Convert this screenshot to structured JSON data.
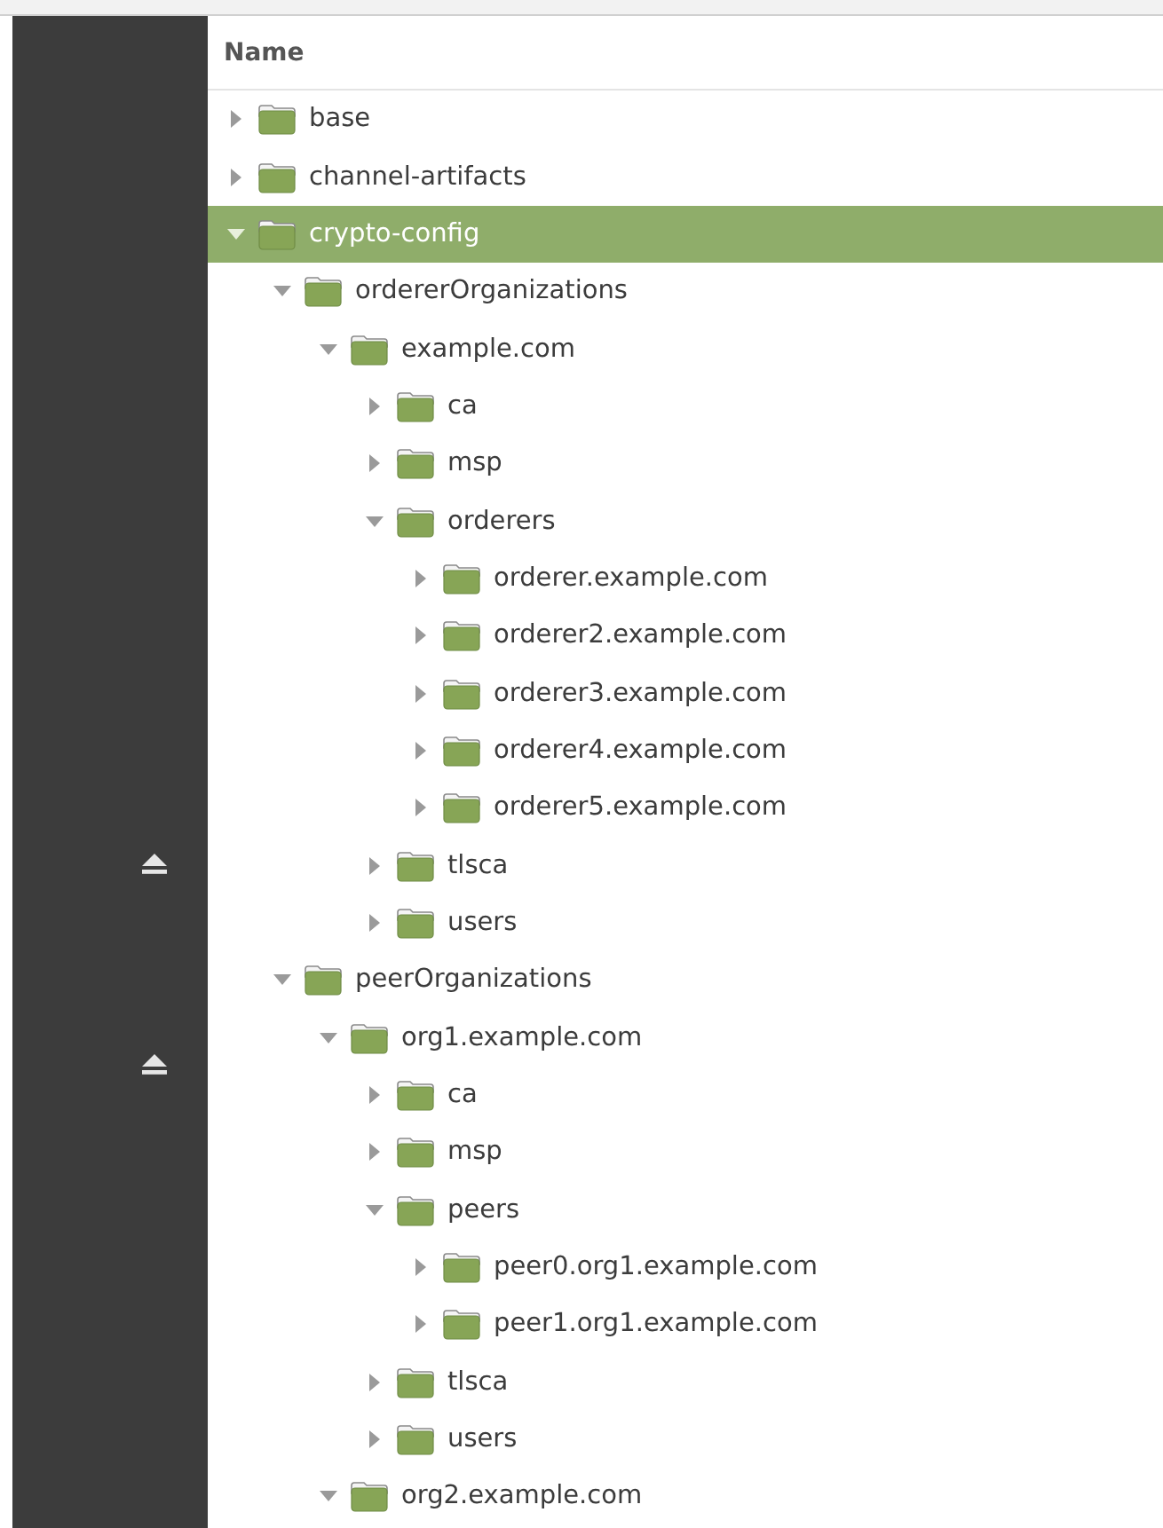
{
  "sidebar": {
    "buttons": [
      {
        "kind": "eject"
      },
      {
        "kind": "eject"
      }
    ]
  },
  "header": {
    "column_1": "Name"
  },
  "tree": [
    {
      "name": "base",
      "expanded": false,
      "selected": false
    },
    {
      "name": "channel-artifacts",
      "expanded": false,
      "selected": false
    },
    {
      "name": "crypto-config",
      "expanded": true,
      "selected": true,
      "children": [
        {
          "name": "ordererOrganizations",
          "expanded": true,
          "selected": false,
          "children": [
            {
              "name": "example.com",
              "expanded": true,
              "selected": false,
              "children": [
                {
                  "name": "ca",
                  "expanded": false,
                  "selected": false
                },
                {
                  "name": "msp",
                  "expanded": false,
                  "selected": false
                },
                {
                  "name": "orderers",
                  "expanded": true,
                  "selected": false,
                  "children": [
                    {
                      "name": "orderer.example.com",
                      "expanded": false,
                      "selected": false
                    },
                    {
                      "name": "orderer2.example.com",
                      "expanded": false,
                      "selected": false
                    },
                    {
                      "name": "orderer3.example.com",
                      "expanded": false,
                      "selected": false
                    },
                    {
                      "name": "orderer4.example.com",
                      "expanded": false,
                      "selected": false
                    },
                    {
                      "name": "orderer5.example.com",
                      "expanded": false,
                      "selected": false
                    }
                  ]
                },
                {
                  "name": "tlsca",
                  "expanded": false,
                  "selected": false
                },
                {
                  "name": "users",
                  "expanded": false,
                  "selected": false
                }
              ]
            }
          ]
        },
        {
          "name": "peerOrganizations",
          "expanded": true,
          "selected": false,
          "children": [
            {
              "name": "org1.example.com",
              "expanded": true,
              "selected": false,
              "children": [
                {
                  "name": "ca",
                  "expanded": false,
                  "selected": false
                },
                {
                  "name": "msp",
                  "expanded": false,
                  "selected": false
                },
                {
                  "name": "peers",
                  "expanded": true,
                  "selected": false,
                  "children": [
                    {
                      "name": "peer0.org1.example.com",
                      "expanded": false,
                      "selected": false
                    },
                    {
                      "name": "peer1.org1.example.com",
                      "expanded": false,
                      "selected": false
                    }
                  ]
                },
                {
                  "name": "tlsca",
                  "expanded": false,
                  "selected": false
                },
                {
                  "name": "users",
                  "expanded": false,
                  "selected": false
                }
              ]
            },
            {
              "name": "org2.example.com",
              "expanded": true,
              "selected": false
            }
          ]
        }
      ]
    }
  ]
}
